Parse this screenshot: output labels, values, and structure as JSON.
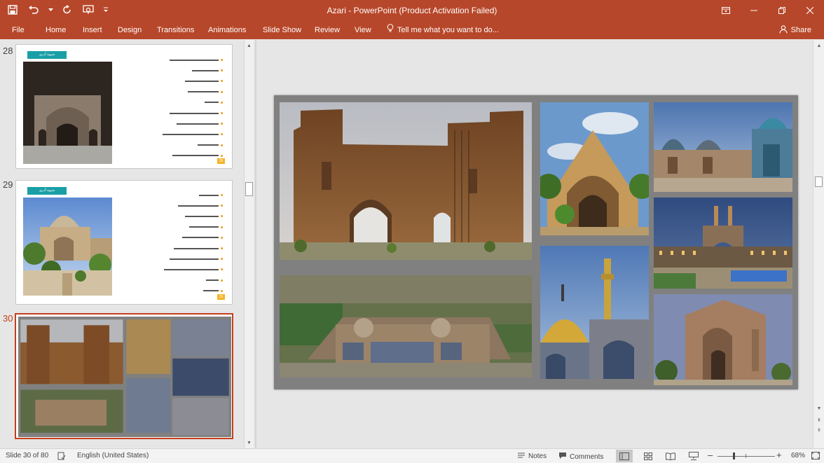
{
  "app": {
    "title": "Azari - PowerPoint (Product Activation Failed)",
    "accent": "#b7472a"
  },
  "ribbon": {
    "tabs": [
      "File",
      "Home",
      "Insert",
      "Design",
      "Transitions",
      "Animations",
      "Slide Show",
      "Review",
      "View"
    ],
    "tell_me": "Tell me what you want to do...",
    "share": "Share"
  },
  "thumbnails": [
    {
      "number": "28",
      "banner": "شیوه آذری",
      "bullets": 11,
      "page_tag": "28"
    },
    {
      "number": "29",
      "banner": "شیوه آذری",
      "bullets": 11,
      "page_tag": "29"
    },
    {
      "number": "30",
      "selected": true
    }
  ],
  "status": {
    "slide_info": "Slide 30 of 80",
    "language": "English (United States)",
    "notes": "Notes",
    "comments": "Comments",
    "zoom": "68%"
  },
  "icons": {
    "save": "save-icon",
    "undo": "undo-icon",
    "redo": "redo-icon",
    "present": "start-from-beginning-icon",
    "customize": "customize-qat-icon",
    "ribbon_display": "ribbon-display-options-icon",
    "minimize": "minimize-icon",
    "maximize": "restore-icon",
    "close": "close-icon",
    "lightbulb": "lightbulb-icon",
    "person": "person-icon"
  }
}
